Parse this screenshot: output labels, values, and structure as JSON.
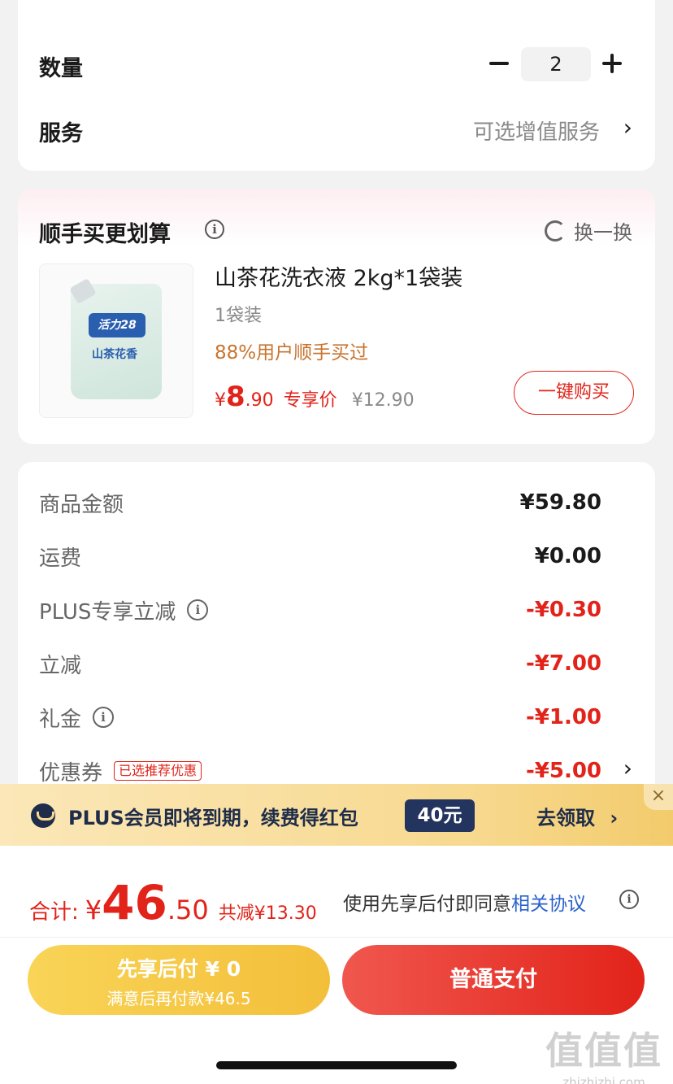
{
  "quantity_section": {
    "quantity_label": "数量",
    "quantity_value": "2",
    "service_label": "服务",
    "service_value": "可选增值服务"
  },
  "addon_section": {
    "title": "顺手买更划算",
    "swap_label": "换一换",
    "product": {
      "name": "山茶花洗衣液 2kg*1袋装",
      "spec": "1袋装",
      "note": "88%用户顺手买过",
      "price_symbol": "¥",
      "price_int": "8",
      "price_dec": ".90",
      "price_tag": "专享价",
      "original_price": "¥12.90",
      "buy_button": "一键购买",
      "image_brand": "活力28",
      "image_text": "山茶花香"
    }
  },
  "summary": {
    "rows": [
      {
        "label": "商品金额",
        "value": "¥59.80"
      },
      {
        "label": "运费",
        "value": "¥0.00"
      },
      {
        "label": "PLUS专享立减",
        "value": "-¥0.30"
      },
      {
        "label": "立减",
        "value": "-¥7.00"
      },
      {
        "label": "礼金",
        "value": "-¥1.00"
      },
      {
        "label": "优惠券",
        "value": "-¥5.00",
        "tag": "已选推荐优惠"
      }
    ]
  },
  "plus_banner": {
    "text": "PLUS会员即将到期，续费得红包",
    "badge": "40元",
    "claim": "去领取",
    "close": "×"
  },
  "checkout": {
    "total_label": "合计:",
    "total_symbol": "¥",
    "total_int": "46",
    "total_dec": ".50",
    "saved": "共减¥13.30",
    "agree_text": "使用先享后付即同意",
    "agree_link": "相关协议",
    "pay_later_line1": "先享后付 ¥ 0",
    "pay_later_line2": "满意后再付款¥46.5",
    "pay_normal": "普通支付"
  },
  "watermark": {
    "big": "值值值",
    "small": "zhizhizhi.com"
  },
  "colors": {
    "accent_red": "#e2231a",
    "note_orange": "#c8742f",
    "plus_navy": "#1f2d4a",
    "link_blue": "#2a62c9"
  }
}
